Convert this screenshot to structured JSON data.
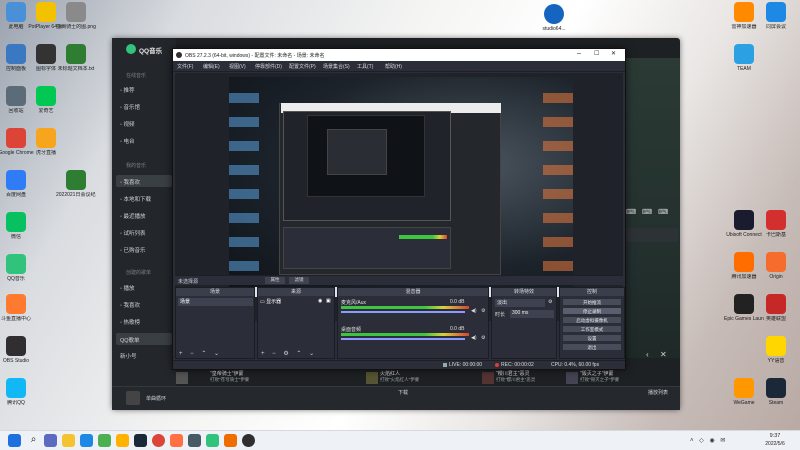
{
  "desktop_left": [
    {
      "label": "此电脑",
      "color": "#4a90d9"
    },
    {
      "label": "PotPlayer 64 bit",
      "color": "#f2c200"
    },
    {
      "label": "亚洲骑士的图.png",
      "color": "#8a8a8a"
    },
    {
      "label": "控制面板",
      "color": "#3b78c2"
    },
    {
      "label": "图标字体",
      "color": "#333333"
    },
    {
      "label": "未标题文档本.txt",
      "color": "#2e7d32"
    },
    {
      "label": "回收站",
      "color": "#5b6b78"
    },
    {
      "label": "爱奇艺",
      "color": "#00c853"
    },
    {
      "label": "Google Chrome",
      "color": "#db4437"
    },
    {
      "label": "虎牙直播",
      "color": "#f7a51c"
    },
    {
      "label": "百度网盘",
      "color": "#2f7cf6"
    },
    {
      "label": "2022021日会议纪要.txt",
      "color": "#2e7d32"
    },
    {
      "label": "微信",
      "color": "#07c160"
    },
    {
      "label": "QQ音乐",
      "color": "#31c27c"
    },
    {
      "label": "斗鱼直播中心",
      "color": "#ff7a2f"
    },
    {
      "label": "OBS Studio",
      "color": "#302e31"
    },
    {
      "label": "腾讯QQ",
      "color": "#12b7f5"
    }
  ],
  "desktop_right": [
    {
      "label": "雷神加速器",
      "color": "#ff8a00"
    },
    {
      "label": "同屏会议",
      "color": "#1e88e5"
    },
    {
      "label": "TEAM",
      "color": "#2aa1e3"
    },
    {
      "label": "Ubisoft Connect",
      "color": "#1b1b2f"
    },
    {
      "label": "卡巴斯基",
      "color": "#d32f2f"
    },
    {
      "label": "腾讯加速器",
      "color": "#ff6d00"
    },
    {
      "label": "Origin",
      "color": "#f56c2d"
    },
    {
      "label": "Epic Games Launcher",
      "color": "#222222"
    },
    {
      "label": "英雄联盟",
      "color": "#c62828"
    },
    {
      "label": "YY语音",
      "color": "#ffd600"
    },
    {
      "label": "WeGame",
      "color": "#ff9800"
    },
    {
      "label": "Steam",
      "color": "#1b2838"
    }
  ],
  "desktop_top": {
    "label": "studio64...",
    "color": "#1565c0"
  },
  "qq_music": {
    "app_name": "QQ音乐",
    "section_online": "在线音乐",
    "items_online": [
      "推荐",
      "音乐馆",
      "视频",
      "电台"
    ],
    "section_mine": "我的音乐",
    "items_mine": [
      "我喜欢",
      "本地和下载",
      "最近播放",
      "试听列表",
      "已购音乐"
    ],
    "section_created": "创建的歌单",
    "items_created": [
      "播放",
      "我喜欢",
      "热歌榜"
    ],
    "playlist_selected": "QQ歌单",
    "more": "新小号",
    "bottom_text": "单曲循环",
    "song_rows": [
      {
        "title": "\"皇帝骑士\"伊蒙",
        "sub": "打败\"苍穹骑士\"伊蒙"
      },
      {
        "title": "火焰红人",
        "sub": "打败\"火焰红人\"伊蒙"
      },
      {
        "title": "\"樱川君主\"恶灵",
        "sub": "打败\"樱川君主\"恶灵"
      },
      {
        "title": "\"毁灭之子\"伊蒙",
        "sub": "打败\"毁灭之子\"伊蒙"
      }
    ],
    "download_label": "下载",
    "playlist_label": "播放列表"
  },
  "obs": {
    "title": "OBS 27.2.3 (64-bit, windows) - 配置文件: 未命名 - 场景: 未命名",
    "menus": [
      "文件(F)",
      "编辑(E)",
      "视图(V)",
      "停靠部件(D)",
      "配置文件(P)",
      "场景集合(S)",
      "工具(T)",
      "帮助(H)"
    ],
    "source_bar": "未选择源",
    "source_bar_btns": [
      "属性",
      "滤镜"
    ],
    "scenes": {
      "header": "场景",
      "item": "场景"
    },
    "sources": {
      "header": "来源",
      "item": "显示器"
    },
    "mixer": {
      "header": "混音器",
      "ch1": "麦克风/Aux",
      "ch2": "桌面音频",
      "db1": "0.0 dB",
      "db2": "0.0 dB"
    },
    "transitions": {
      "header": "转场特效",
      "type": "淡出",
      "duration_label": "时长",
      "duration": "300 ms"
    },
    "controls": {
      "header": "控制",
      "buttons": [
        "开始推流",
        "停止录制",
        "启动虚拟摄像机",
        "工作室模式",
        "设置",
        "退出"
      ]
    },
    "status": {
      "live": "LIVE: 00:00:00",
      "rec": "REC: 00:00:02",
      "cpu": "CPU: 0.4%, 60.00 fps"
    }
  },
  "taskbar": {
    "time": "9:37",
    "date": "2022/5/6"
  }
}
